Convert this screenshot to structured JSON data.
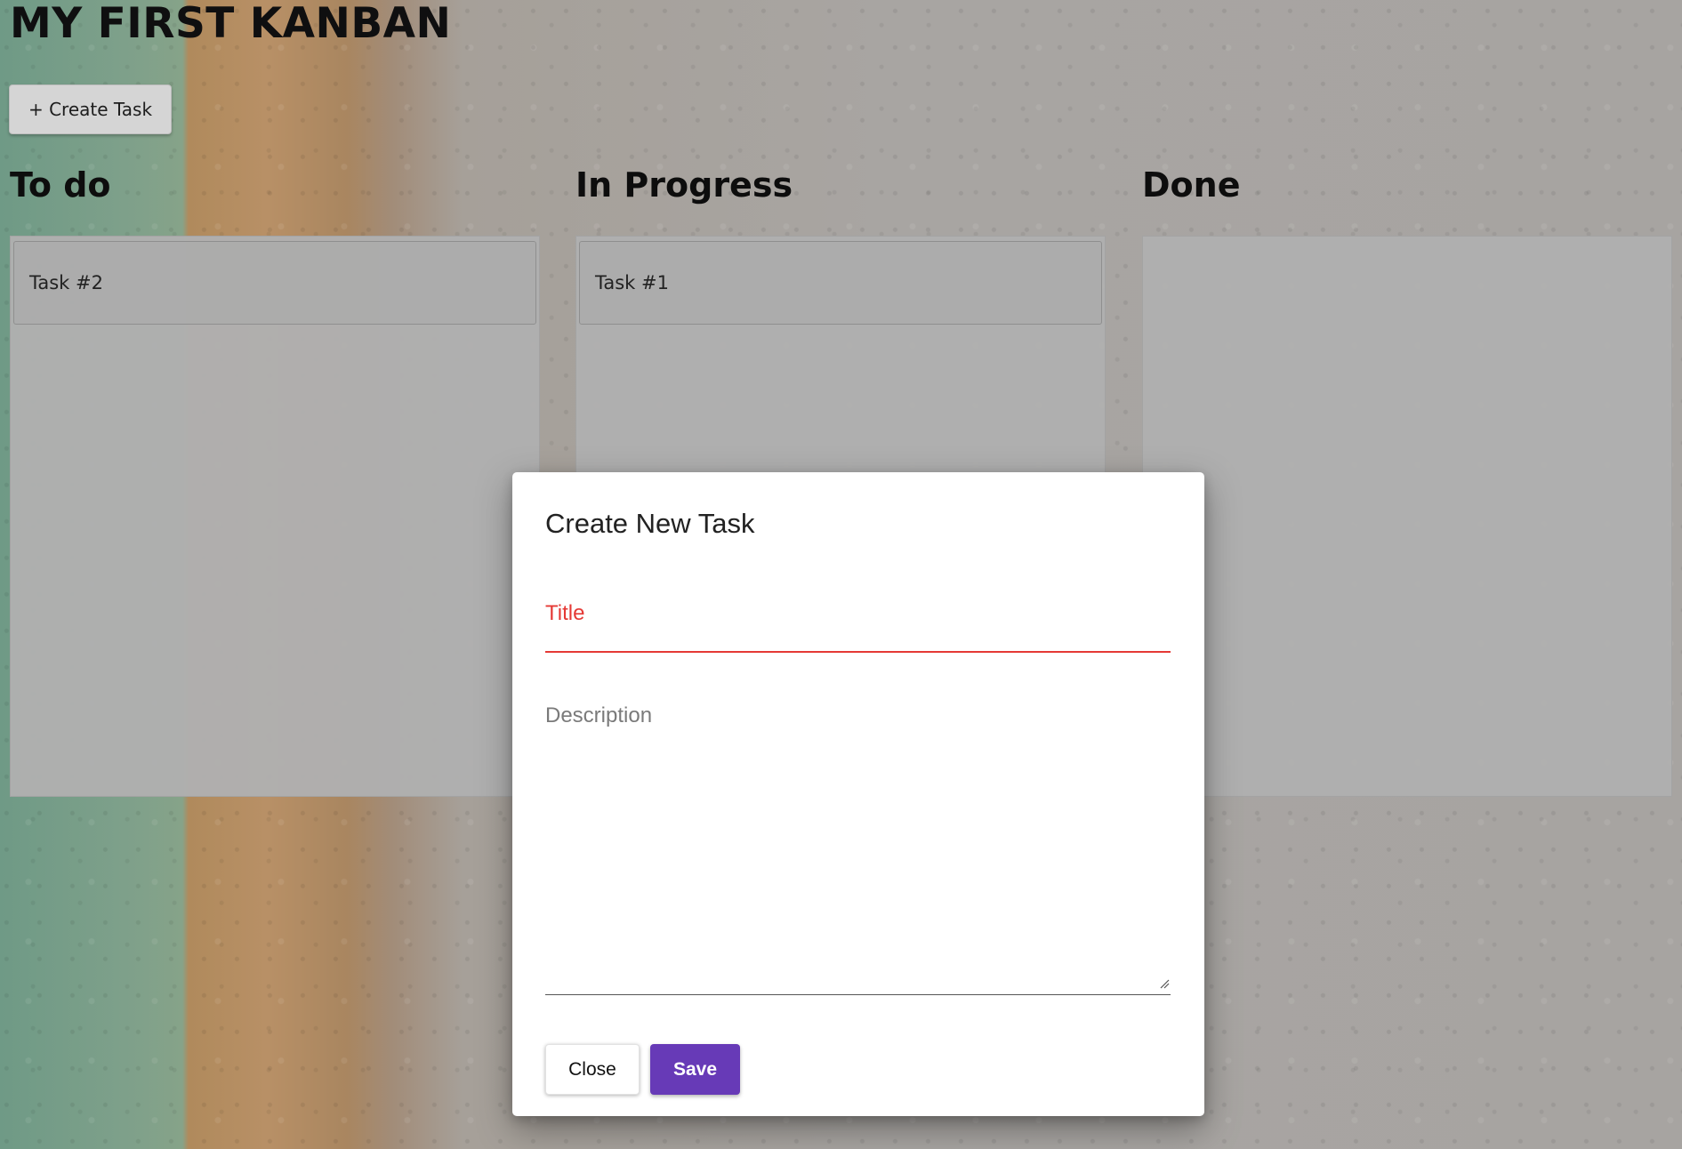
{
  "app": {
    "title": "MY FIRST KANBAN"
  },
  "toolbar": {
    "create_task_label": "+ Create Task"
  },
  "columns": [
    {
      "title": "To do",
      "tasks": [
        "Task #2"
      ]
    },
    {
      "title": "In Progress",
      "tasks": [
        "Task #1"
      ]
    },
    {
      "title": "Done",
      "tasks": []
    }
  ],
  "modal": {
    "title": "Create New Task",
    "title_field_label": "Title",
    "description_field_label": "Description",
    "close_label": "Close",
    "save_label": "Save"
  },
  "colors": {
    "accent": "#673ab7",
    "error": "#e53935"
  }
}
